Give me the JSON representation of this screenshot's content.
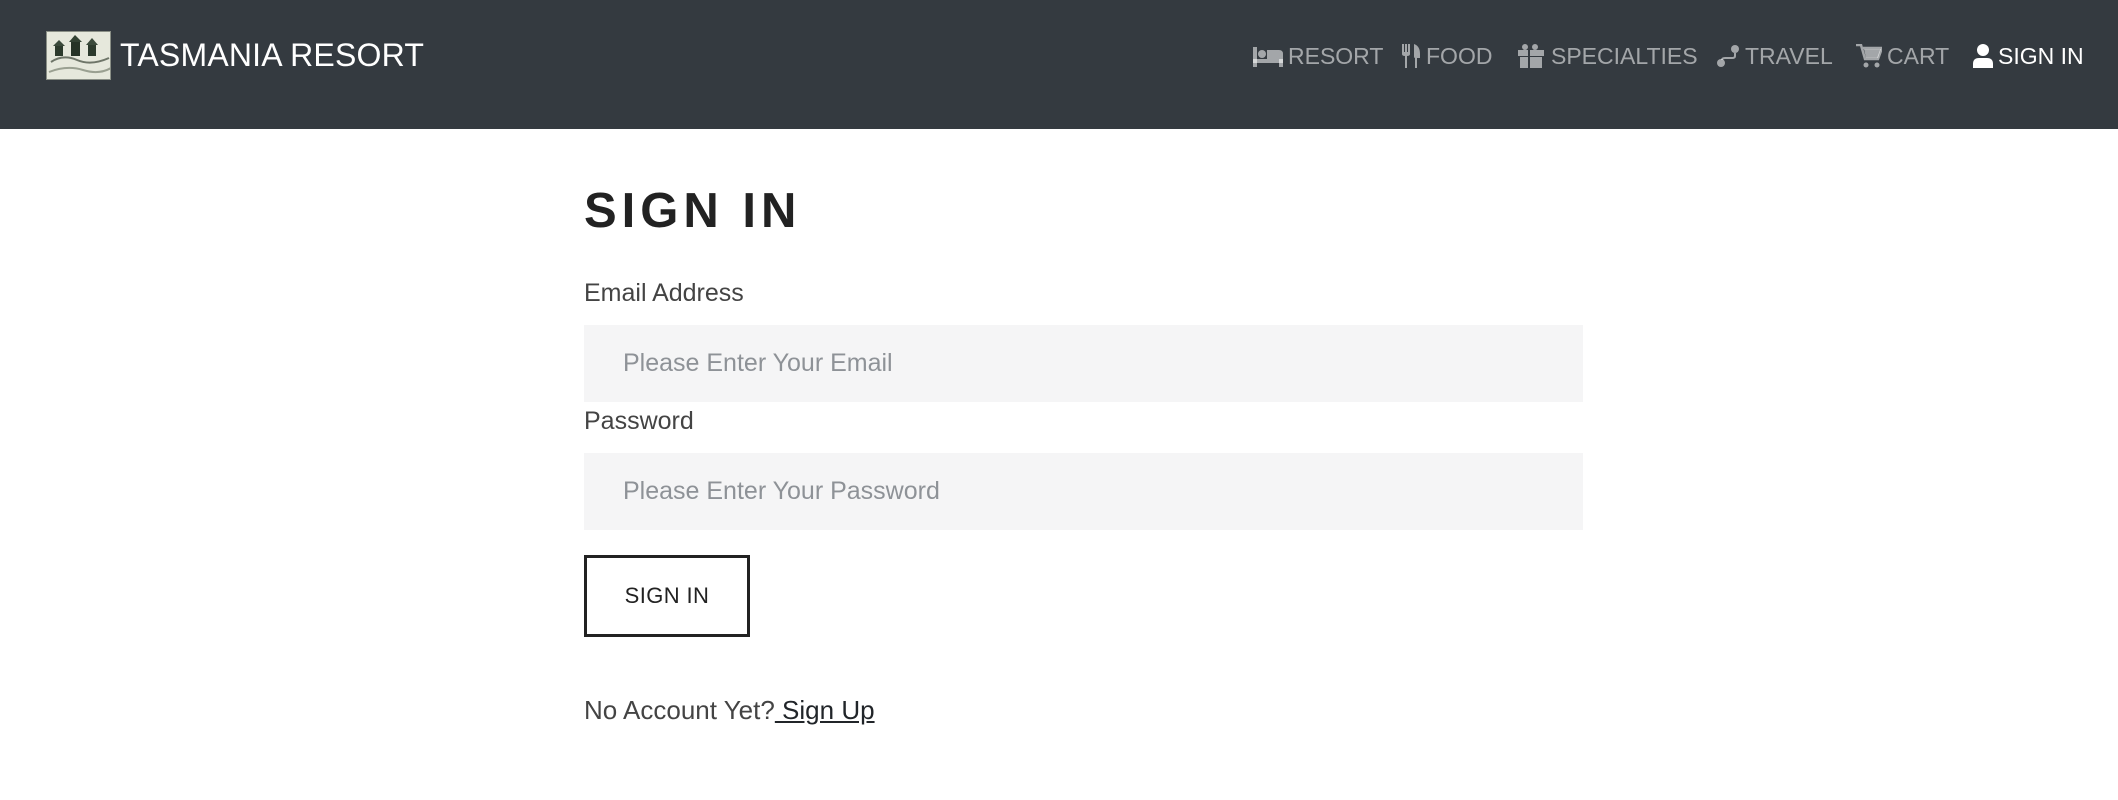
{
  "brand": {
    "name": "TASMANIA RESORT",
    "logo": "resort-landscape-logo"
  },
  "nav": {
    "items": [
      {
        "label": "RESORT",
        "icon": "bed-icon",
        "active": false
      },
      {
        "label": "FOOD",
        "icon": "utensils-icon",
        "active": false
      },
      {
        "label": "SPECIALTIES",
        "icon": "gift-icon",
        "active": false
      },
      {
        "label": "TRAVEL",
        "icon": "route-icon",
        "active": false
      },
      {
        "label": "CART",
        "icon": "cart-icon",
        "active": false
      },
      {
        "label": "SIGN IN",
        "icon": "user-icon",
        "active": true
      }
    ]
  },
  "form": {
    "title": "SIGN IN",
    "email_label": "Email Address",
    "email_placeholder": "Please Enter Your Email",
    "email_value": "",
    "password_label": "Password",
    "password_placeholder": "Please Enter Your Password",
    "password_value": "",
    "submit_label": "SIGN IN",
    "no_account_text": "No Account Yet?",
    "signup_link": " Sign Up"
  },
  "colors": {
    "navbar": "#343a40",
    "nav_inactive": "rgba(255,255,255,0.55)",
    "nav_active": "#ffffff",
    "input_bg": "#f5f5f6"
  }
}
